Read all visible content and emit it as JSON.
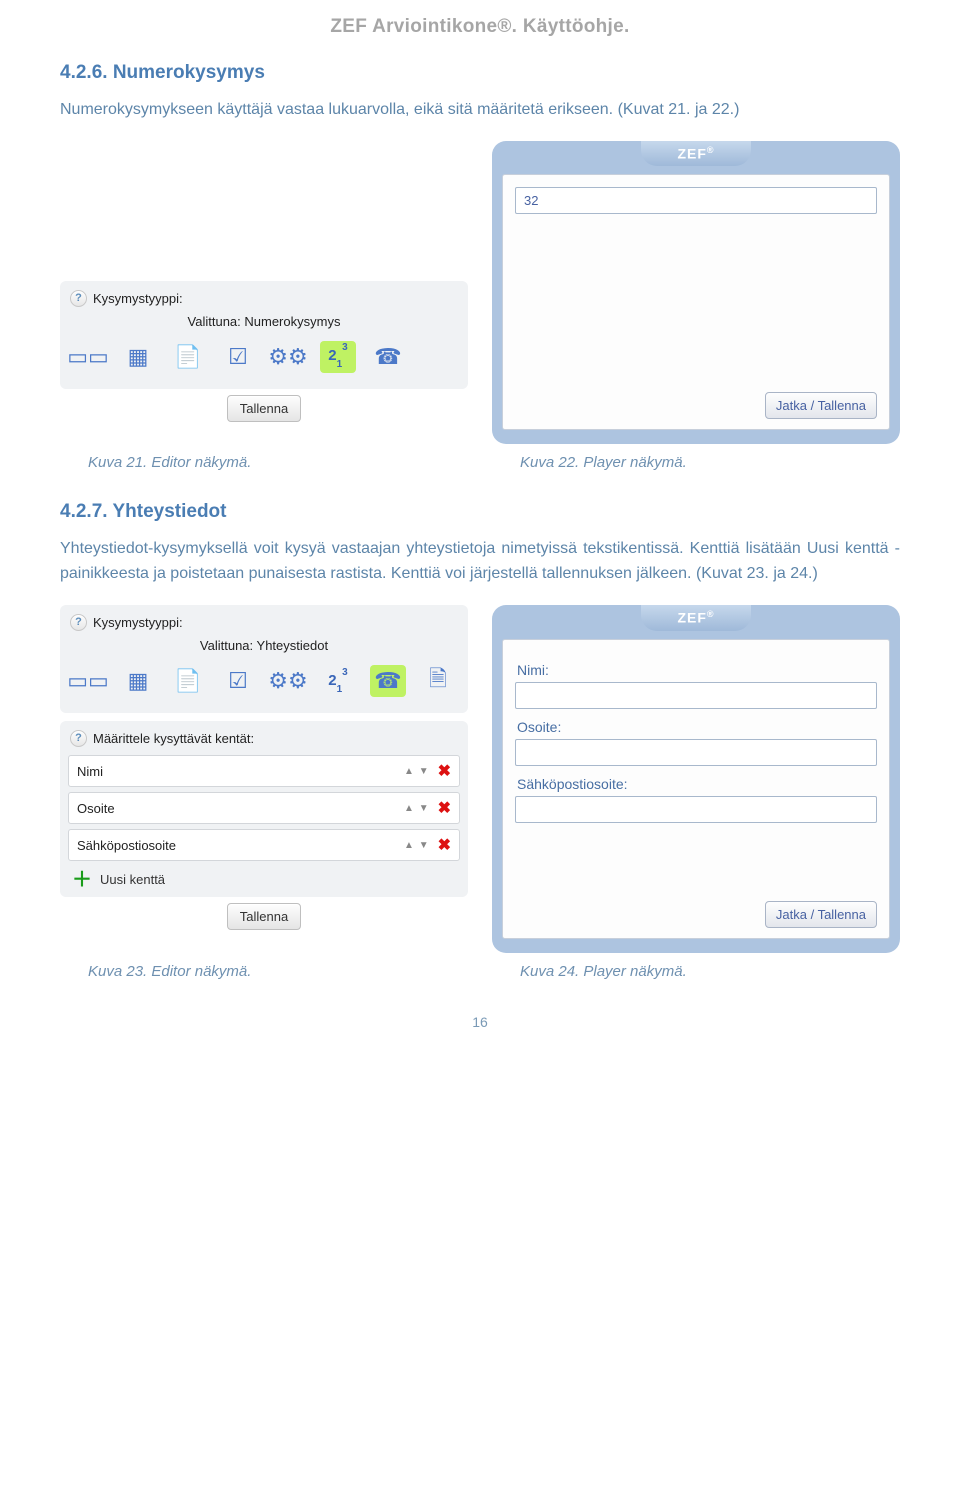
{
  "header": "ZEF Arviointikone®. Käyttöohje.",
  "sec1": {
    "number": "4.2.6. Numerokysymys",
    "para": "Numerokysymykseen käyttäjä vastaa lukuarvolla, eikä sitä määritetä erikseen. (Kuvat 21. ja 22.)"
  },
  "editor1": {
    "label": "Kysymystyyppi:",
    "valittuna": "Valittuna: Numerokysymys",
    "save": "Tallenna"
  },
  "player1": {
    "brand": "ZEF",
    "value": "32",
    "jatka": "Jatka / Tallenna"
  },
  "cap1a": "Kuva 21. Editor näkymä.",
  "cap1b": "Kuva 22. Player näkymä.",
  "sec2": {
    "number": "4.2.7. Yhteystiedot",
    "para": "Yhteystiedot-kysymyksellä voit kysyä vastaajan yhteystietoja nimetyissä tekstikentissä. Kenttiä lisätään Uusi kenttä -painikkeesta ja poistetaan punaisesta rastista. Kenttiä voi järjestellä tallennuksen jälkeen. (Kuvat 23. ja 24.)"
  },
  "editor2": {
    "label": "Kysymystyyppi:",
    "valittuna": "Valittuna: Yhteystiedot",
    "save": "Tallenna",
    "kentatLabel": "Määrittele kysyttävät kentät:",
    "fields": [
      "Nimi",
      "Osoite",
      "Sähköpostiosoite"
    ],
    "uusi": "Uusi kenttä"
  },
  "player2": {
    "brand": "ZEF",
    "labels": {
      "f1": "Nimi:",
      "f2": "Osoite:",
      "f3": "Sähköpostiosoite:"
    },
    "jatka": "Jatka / Tallenna"
  },
  "cap2a": "Kuva 23. Editor näkymä.",
  "cap2b": "Kuva 24. Player näkymä.",
  "pageNum": "16"
}
